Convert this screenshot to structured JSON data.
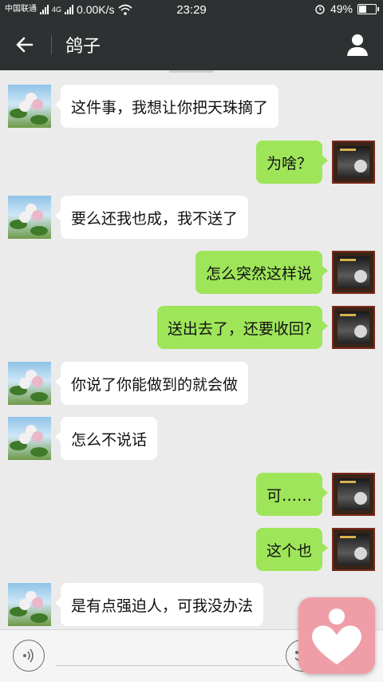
{
  "status_bar": {
    "carrier": "中国联通",
    "network": "4G",
    "speed": "0.00K/s",
    "time": "23:29",
    "battery": "49%",
    "battery_level": 0.49
  },
  "header": {
    "title": "鸽子"
  },
  "messages": [
    {
      "side": "in",
      "text": "这件事，我想让你把天珠摘了"
    },
    {
      "side": "out",
      "text": "为啥？"
    },
    {
      "side": "in",
      "text": "要么还我也成，我不送了"
    },
    {
      "side": "out",
      "text": "怎么突然这样说"
    },
    {
      "side": "out",
      "text": "送出去了，还要收回?"
    },
    {
      "side": "in",
      "text": "你说了你能做到的就会做"
    },
    {
      "side": "in",
      "text": "怎么不说话"
    },
    {
      "side": "out",
      "text": "可……"
    },
    {
      "side": "out",
      "text": "这个也"
    },
    {
      "side": "in",
      "text": "是有点强迫人，可我没办法"
    }
  ],
  "colors": {
    "header_bg": "#2e3132",
    "chat_bg": "#ebebeb",
    "bubble_in": "#ffffff",
    "bubble_out": "#9ee55a",
    "floating_widget": "#ef9ea8"
  },
  "icons": {
    "back": "arrow-left-icon",
    "profile": "person-icon",
    "voice": "voice-icon",
    "emoji": "emoji-icon",
    "floating": "heart-icon"
  }
}
